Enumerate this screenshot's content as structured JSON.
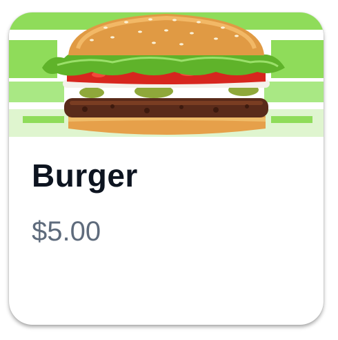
{
  "product": {
    "name": "Burger",
    "price": "$5.00",
    "image_subject": "burger-photo"
  },
  "colors": {
    "background_green": "#8fdc5a",
    "title_text": "#0d1420",
    "price_text": "#5e6b7c",
    "card_bg": "#ffffff"
  }
}
